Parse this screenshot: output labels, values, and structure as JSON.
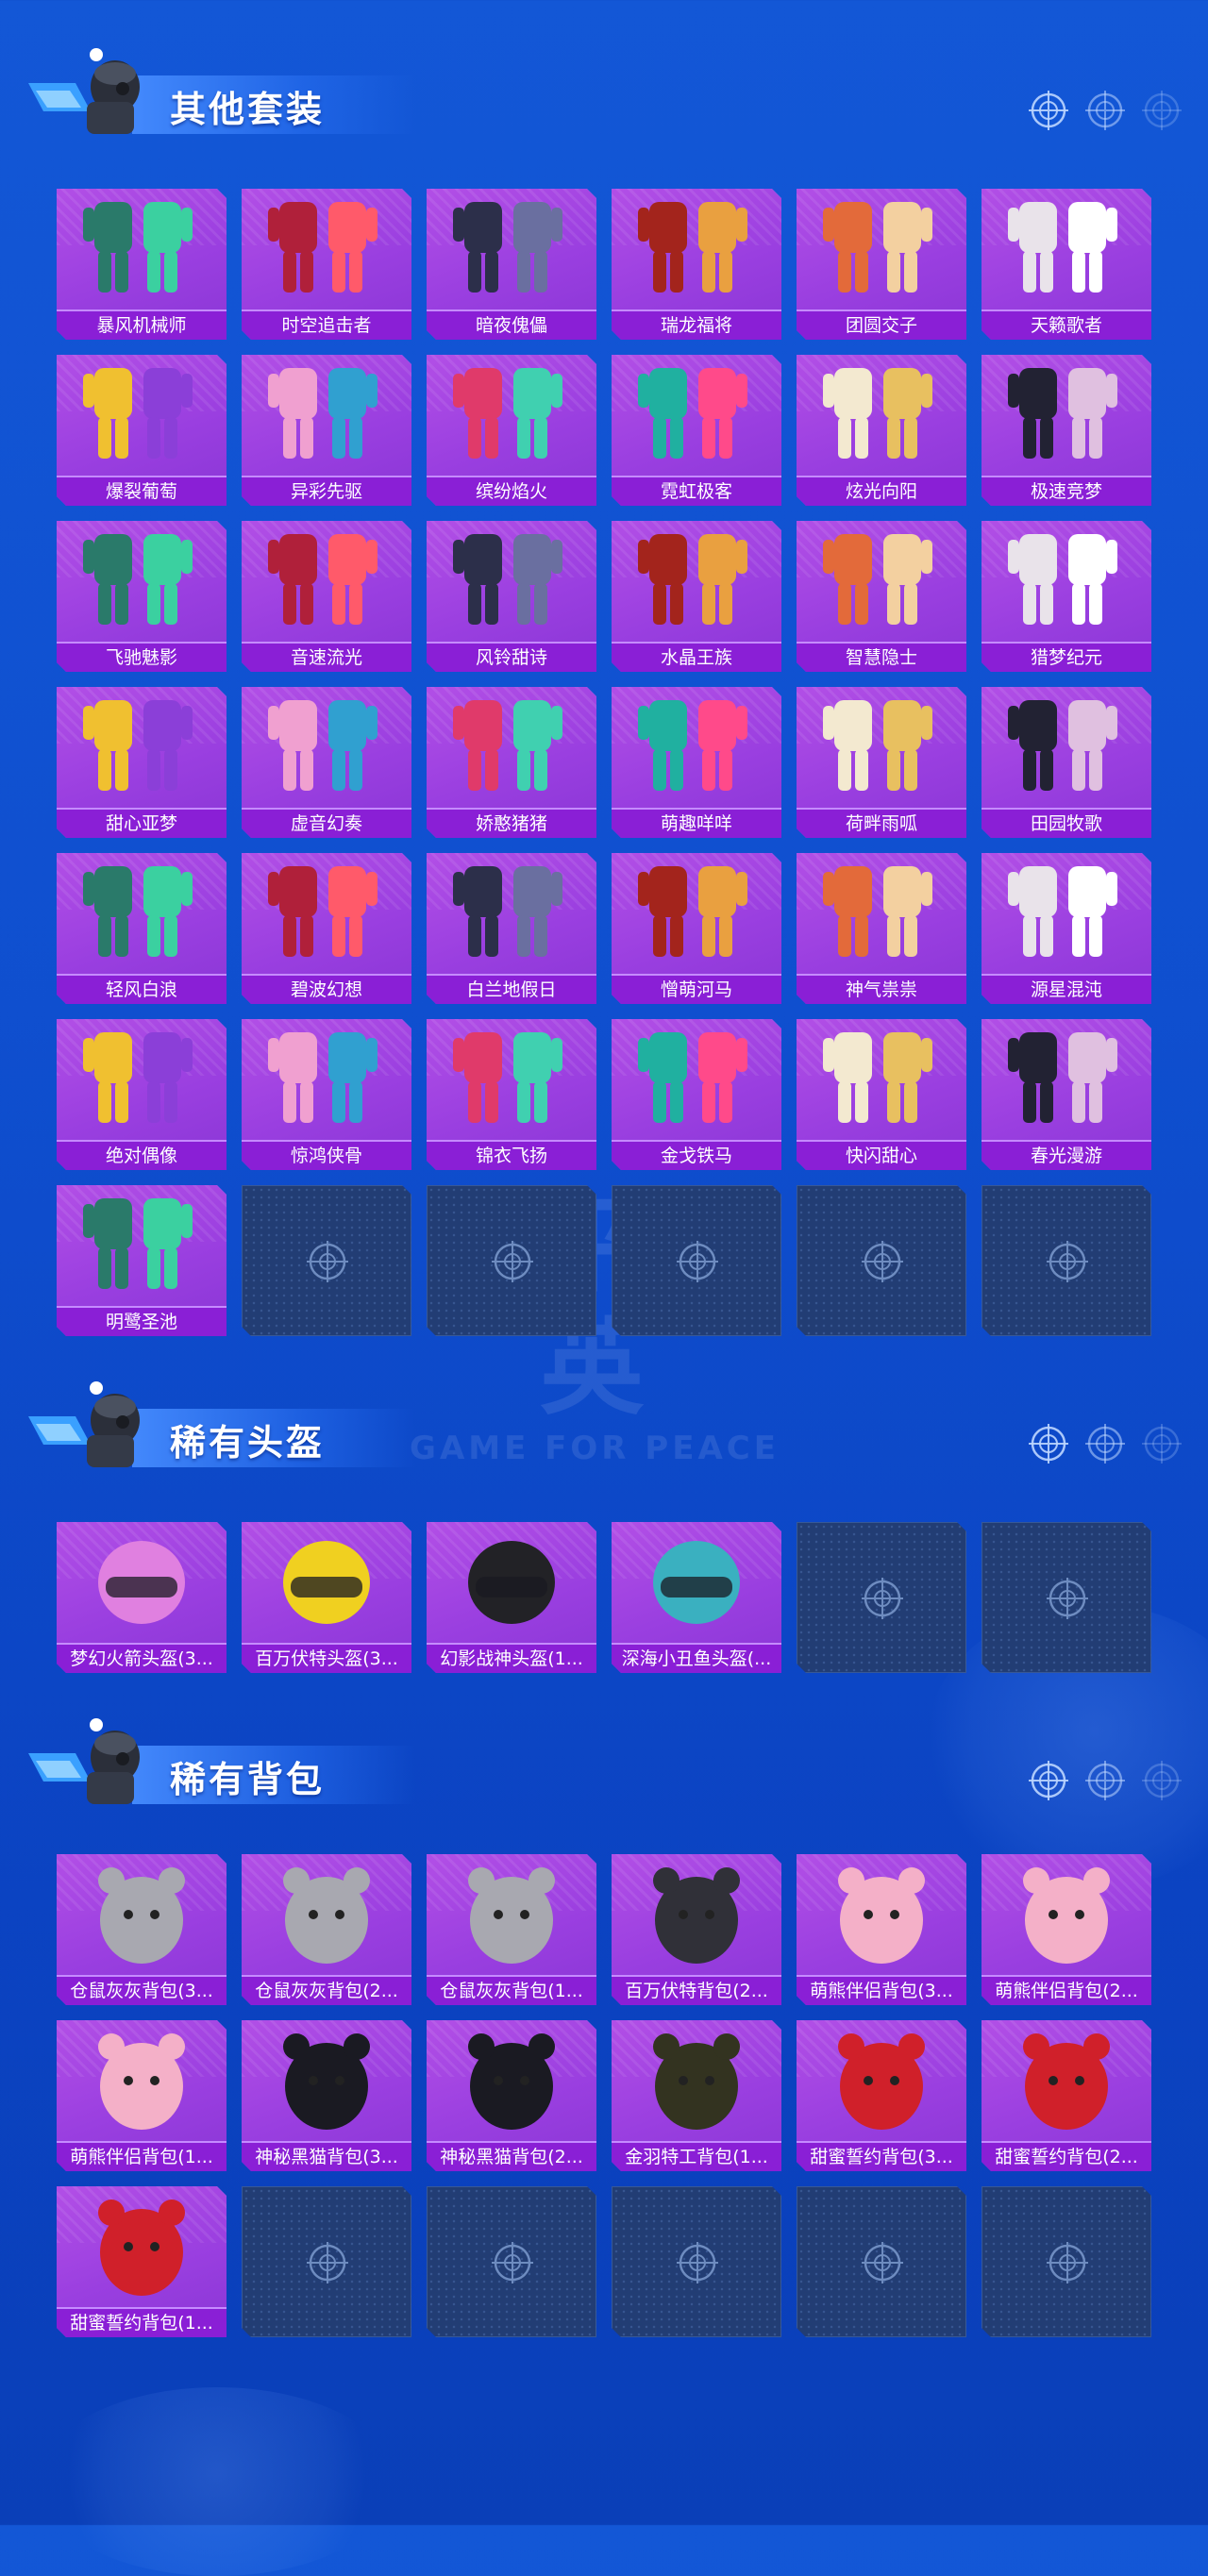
{
  "watermark": {
    "big": "和平精英",
    "small": "GAME FOR PEACE"
  },
  "sections": [
    {
      "title": "其他套装",
      "items": [
        "暴风机械师",
        "时空追击者",
        "暗夜傀儡",
        "瑞龙福将",
        "团圆交子",
        "天籁歌者",
        "爆裂葡萄",
        "异彩先驱",
        "缤纷焰火",
        "霓虹极客",
        "炫光向阳",
        "极速竞梦",
        "飞驰魅影",
        "音速流光",
        "风铃甜诗",
        "水晶王族",
        "智慧隐士",
        "猎梦纪元",
        "甜心亚梦",
        "虚音幻奏",
        "娇憨猪猪",
        "萌趣咩咩",
        "荷畔雨呱",
        "田园牧歌",
        "轻风白浪",
        "碧波幻想",
        "白兰地假日",
        "憎萌河马",
        "神气祟祟",
        "源星混沌",
        "绝对偶像",
        "惊鸿侠骨",
        "锦衣飞扬",
        "金戈铁马",
        "快闪甜心",
        "春光漫游",
        "明鹭圣池"
      ],
      "empty_slots": 5
    },
    {
      "title": "稀有头盔",
      "items": [
        "梦幻火箭头盔(3...",
        "百万伏特头盔(3...",
        "幻影战神头盔(1...",
        "深海小丑鱼头盔(..."
      ],
      "empty_slots": 2
    },
    {
      "title": "稀有背包",
      "items": [
        "仓鼠灰灰背包(3...",
        "仓鼠灰灰背包(2...",
        "仓鼠灰灰背包(1...",
        "百万伏特背包(2...",
        "萌熊伴侣背包(3...",
        "萌熊伴侣背包(2...",
        "萌熊伴侣背包(1...",
        "神秘黑猫背包(3...",
        "神秘黑猫背包(2...",
        "金羽特工背包(1...",
        "甜蜜誓约背包(3...",
        "甜蜜誓约背包(2...",
        "甜蜜誓约背包(1..."
      ],
      "empty_slots": 5
    }
  ],
  "colors": {
    "background": "#1357d6",
    "tile": "#a645e2",
    "label": "#8a1fd6",
    "empty": "#223d74"
  },
  "icons": {
    "mascot": "soldier-mascot-icon",
    "slot": "crosshair-icon"
  }
}
